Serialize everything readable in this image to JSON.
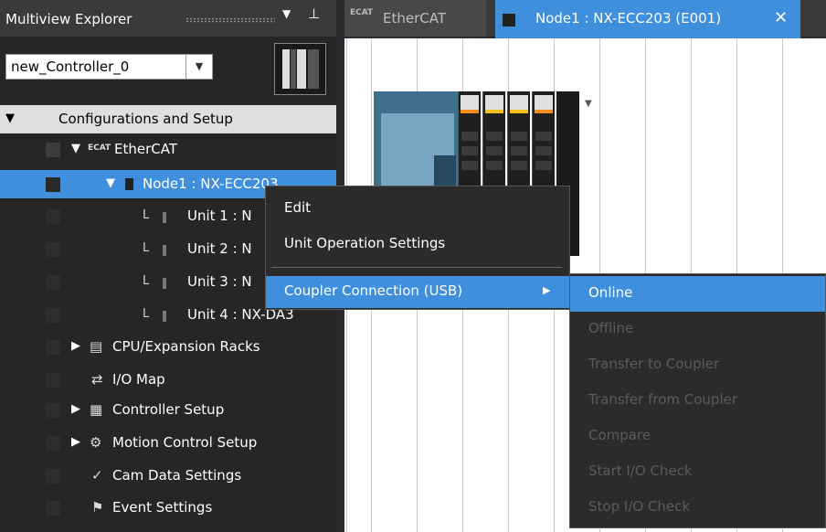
{
  "explorer": {
    "title": "Multiview Explorer",
    "pin_icon": "pin-icon",
    "controller_select": {
      "value": "new_Controller_0"
    },
    "tree": {
      "config": "Configurations and Setup",
      "ethercat": "EtherCAT",
      "node1": "Node1 : NX-ECC203",
      "unit1": "Unit 1 : N",
      "unit2": "Unit 2 : N",
      "unit3": "Unit 3 : N",
      "unit4": "Unit 4 : NX-DA3",
      "cpu": "CPU/Expansion Racks",
      "io": "I/O Map",
      "ctrl": "Controller Setup",
      "motion": "Motion Control Setup",
      "cam": "Cam Data Settings",
      "event": "Event Settings"
    }
  },
  "tabs": {
    "ethercat": {
      "label": "EtherCAT",
      "icon_text": "ECAT"
    },
    "node1": {
      "label": "Node1 : NX-ECC203 (E001)",
      "close": "✕"
    }
  },
  "context_menu": {
    "edit": "Edit",
    "unit_operation": "Unit Operation Settings",
    "coupler_connection": "Coupler Connection (USB)"
  },
  "submenu": {
    "online": "Online",
    "offline": "Offline",
    "transfer_to": "Transfer to Coupler",
    "transfer_from": "Transfer from Coupler",
    "compare": "Compare",
    "start_io": "Start I/O Check",
    "stop_io": "Stop I/O Check"
  },
  "colors": {
    "accent": "#3f8fdd",
    "panel": "#262626",
    "disabled_text": "#5a5a5a"
  }
}
